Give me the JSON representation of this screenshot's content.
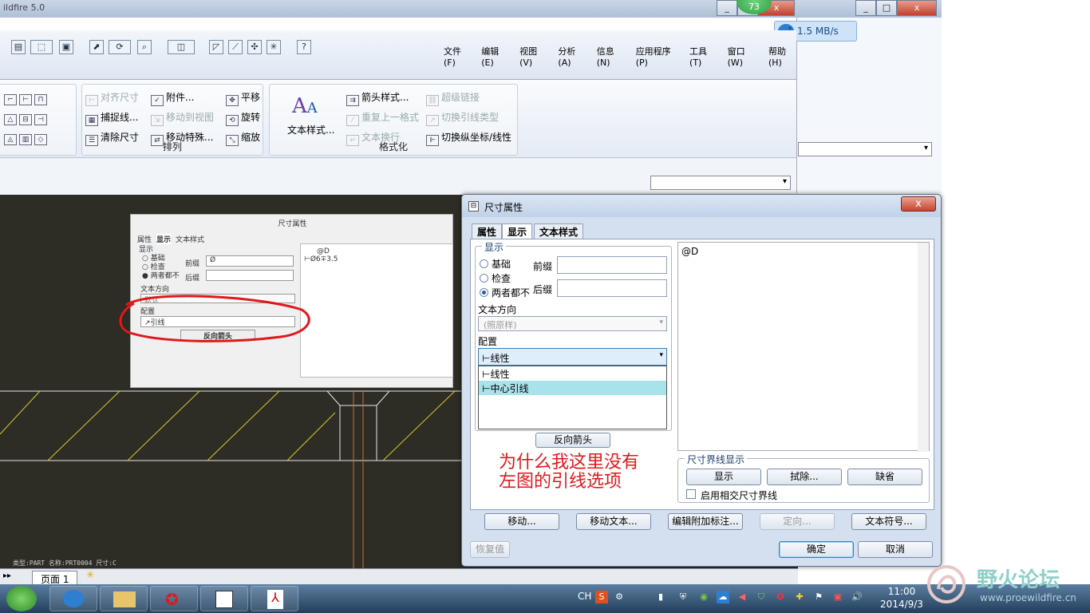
{
  "window": {
    "title": "ildfire 5.0"
  },
  "net_badge": "73",
  "net_speed": "1.5 MB/s",
  "menu": [
    "文件(F)",
    "编辑(E)",
    "视图(V)",
    "分析(A)",
    "信息(N)",
    "应用程序(P)",
    "工具(T)",
    "窗口(W)",
    "帮助(H)"
  ],
  "ribbon": {
    "arrange": {
      "label": "排列",
      "items": [
        {
          "text": "对齐尺寸",
          "enabled": false
        },
        {
          "text": "附件...",
          "enabled": true
        },
        {
          "text": "平移",
          "enabled": true
        },
        {
          "text": "捕捉线...",
          "enabled": true
        },
        {
          "text": "移动到视图",
          "enabled": false
        },
        {
          "text": "旋转",
          "enabled": true
        },
        {
          "text": "清除尺寸",
          "enabled": true
        },
        {
          "text": "移动特殊...",
          "enabled": true
        },
        {
          "text": "缩放",
          "enabled": true
        }
      ]
    },
    "format": {
      "label": "格式化",
      "text_style": "文本样式...",
      "items": [
        {
          "text": "箭头样式...",
          "enabled": true
        },
        {
          "text": "超级链接",
          "enabled": false
        },
        {
          "text": "重复上一格式",
          "enabled": false
        },
        {
          "text": "切换引线类型",
          "enabled": false
        },
        {
          "text": "文本换行",
          "enabled": false
        },
        {
          "text": "切换纵坐标/线性",
          "enabled": true
        }
      ]
    }
  },
  "inset": {
    "title": "尺寸属性",
    "tabs": [
      "属性",
      "显示",
      "文本样式"
    ],
    "display_legend": "显示",
    "radios": [
      "基础",
      "检查",
      "两者都不"
    ],
    "prefix_label": "前缀",
    "prefix_value": "Ø",
    "suffix_label": "后缀",
    "text_dir_label": "文本方向",
    "text_dir_value": "默认",
    "config_label": "配置",
    "config_value": "引线",
    "flip_button": "反向箭头",
    "preview_top": "@D",
    "preview_text": "Ø6∓3.5"
  },
  "dialog": {
    "title": "尺寸属性",
    "close": "x",
    "tabs": [
      "属性",
      "显示",
      "文本样式"
    ],
    "display_legend": "显示",
    "radios": [
      "基础",
      "检查",
      "两者都不"
    ],
    "prefix_label": "前缀",
    "suffix_label": "后缀",
    "text_dir_label": "文本方向",
    "text_dir_value": "(照原样)",
    "config_label": "配置",
    "config_value": "线性",
    "config_options": [
      "线性",
      "中心引线"
    ],
    "flip_button": "反向箭头",
    "text_area": "@D",
    "witness_legend": "尺寸界线显示",
    "witness_buttons": [
      "显示",
      "拭除...",
      "缺省"
    ],
    "witness_checkbox": "启用相交尺寸界线",
    "bottom_buttons": [
      "移动...",
      "移动文本...",
      "编辑附加标注...",
      "定向...",
      "文本符号..."
    ],
    "restore": "恢复值",
    "ok": "确定",
    "cancel": "取消"
  },
  "annotation": {
    "line1": "为什么我这里没有",
    "line2": "左图的引线选项"
  },
  "statusbar": {
    "left": "类型:PART  名称:PRT0004  尺寸:C",
    "page_tab": "页面 1"
  },
  "taskbar": {
    "lang": "CH",
    "time": "11:00",
    "date": "2014/9/3"
  },
  "watermark": {
    "name": "野火论坛",
    "url": "www.proewildfire.cn"
  }
}
